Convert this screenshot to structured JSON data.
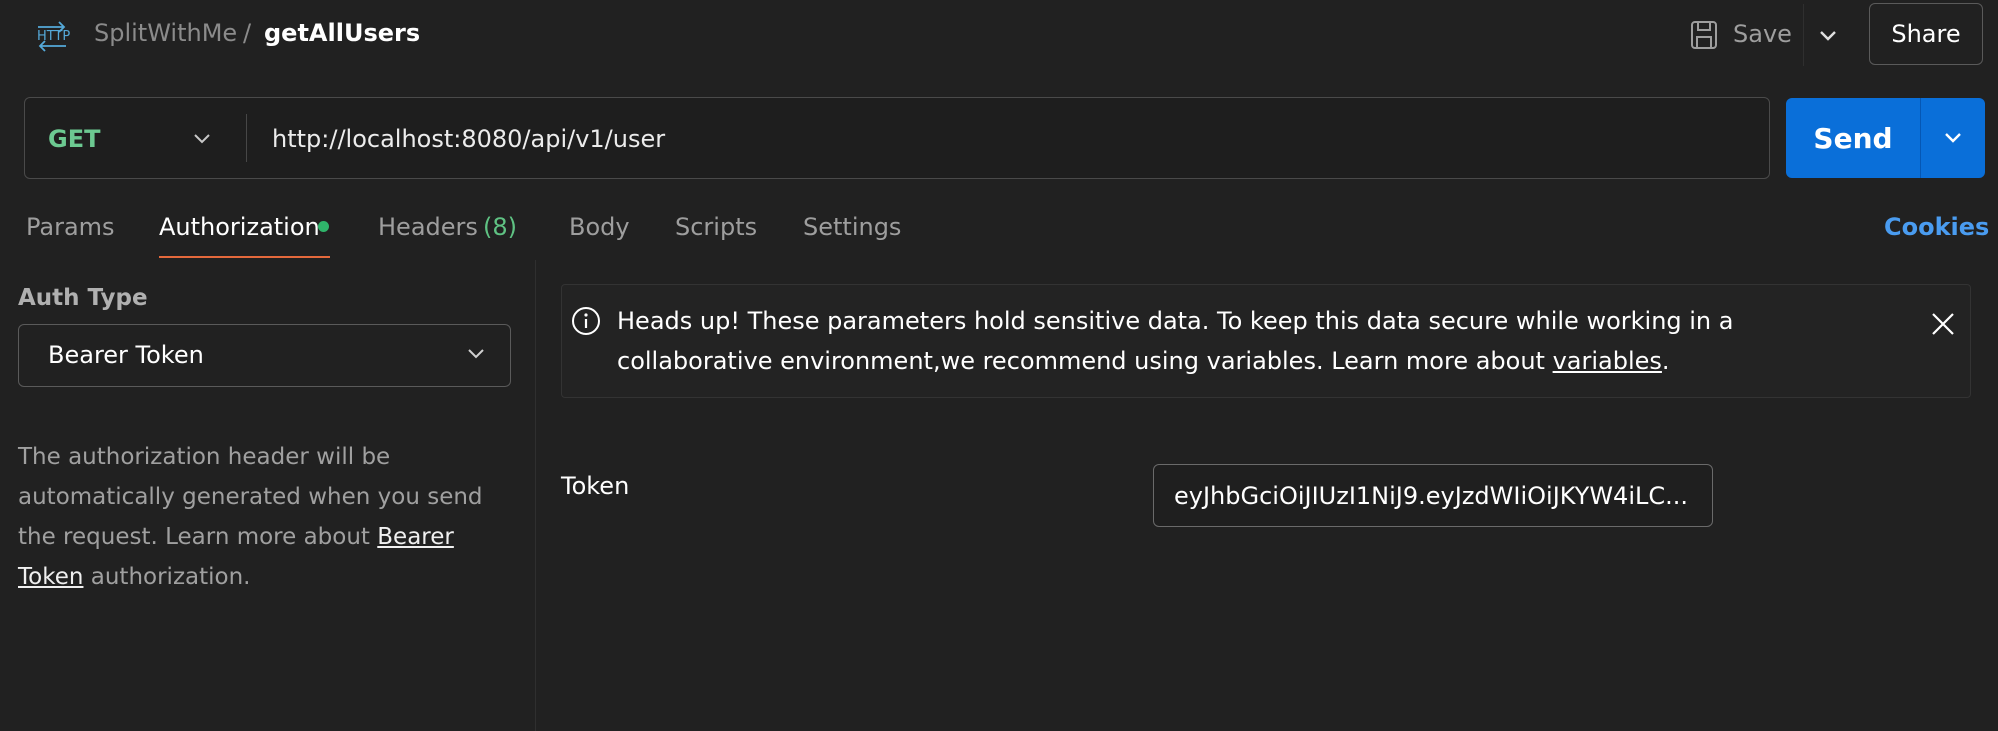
{
  "header": {
    "icon": "http-icon",
    "breadcrumb": {
      "parent": "SplitWithMe",
      "separator": "/",
      "current": "getAllUsers"
    },
    "save_label": "Save",
    "share_label": "Share"
  },
  "request": {
    "method": "GET",
    "url": "http://localhost:8080/api/v1/user",
    "send_label": "Send"
  },
  "tabs": [
    {
      "label": "Params"
    },
    {
      "label": "Authorization",
      "active": true,
      "indicator": "green-dot"
    },
    {
      "label": "Headers",
      "count": "(8)"
    },
    {
      "label": "Body"
    },
    {
      "label": "Scripts"
    },
    {
      "label": "Settings"
    }
  ],
  "cookies_label": "Cookies",
  "auth": {
    "type_label": "Auth Type",
    "selected_type": "Bearer Token",
    "description_part1": "The authorization header will be automatically generated when you send the request. Learn more about ",
    "description_link": "Bearer Token",
    "description_part2": " authorization."
  },
  "banner": {
    "text_part1": "Heads up! These parameters hold sensitive data. To keep this data secure while working in a collaborative environment,we recommend using variables. Learn more about ",
    "link": "variables",
    "text_part2": "."
  },
  "token": {
    "label": "Token",
    "value": "eyJhbGciOiJIUzI1NiJ9.eyJzdWIiOiJKYW4iLC..."
  },
  "colors": {
    "background": "#212121",
    "method_get": "#6cc991",
    "send_button": "#0a6fd9",
    "active_tab_underline": "#e5693c",
    "cookies_link": "#4a9cf0",
    "status_dot": "#2fb46a"
  }
}
